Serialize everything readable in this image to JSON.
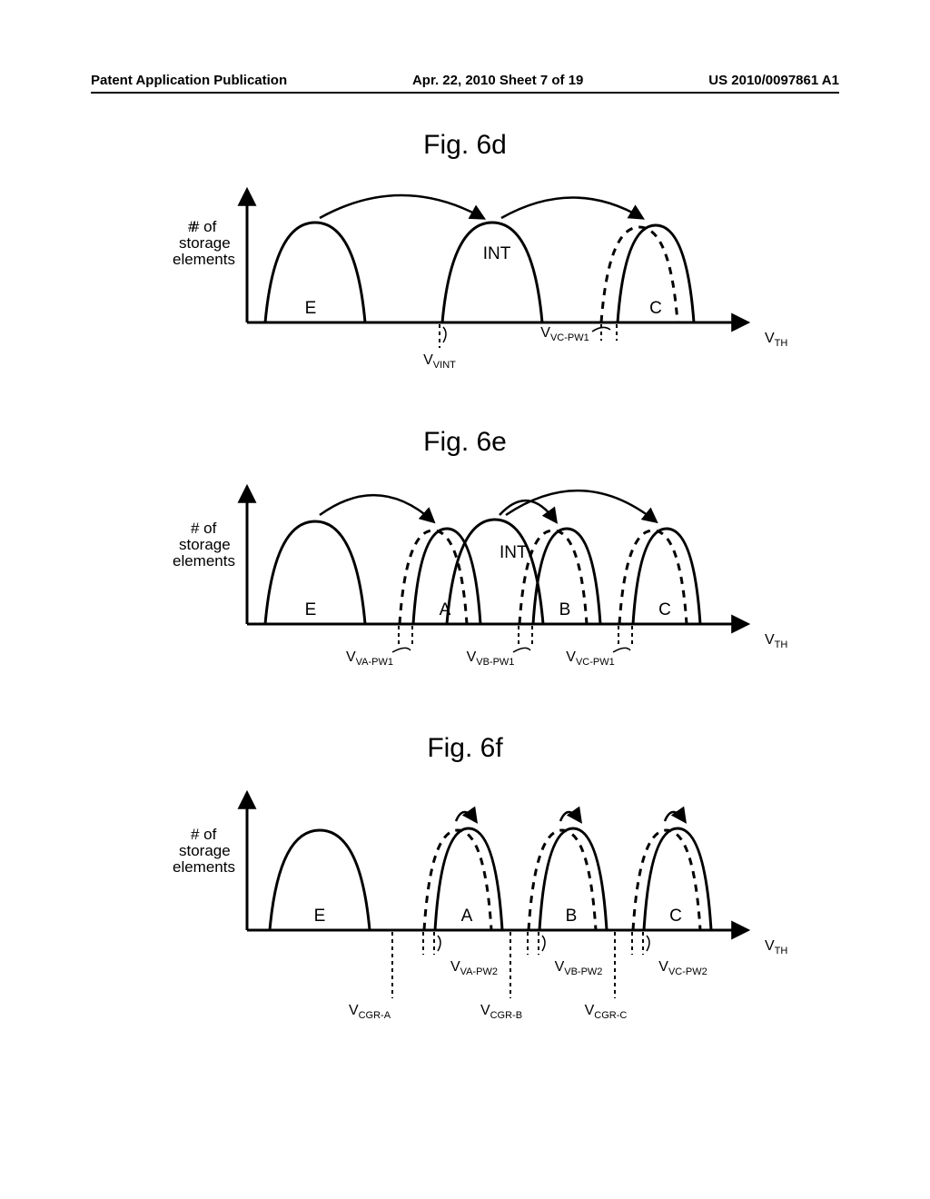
{
  "header": {
    "left": "Patent Application Publication",
    "center": "Apr. 22, 2010  Sheet 7 of 19",
    "right": "US 2010/0097861 A1"
  },
  "figures": {
    "d": {
      "title": "Fig. 6d",
      "ylabel": "# of\nstorage\nelements",
      "xaxis": "V_TH",
      "states": {
        "E": "E",
        "INT": "INT",
        "C": "C"
      },
      "ticks": {
        "vint": "V_VINT",
        "vc": "V_VC-PW1"
      }
    },
    "e": {
      "title": "Fig. 6e",
      "ylabel": "# of\nstorage\nelements",
      "xaxis": "V_TH",
      "states": {
        "E": "E",
        "INT": "INT",
        "A": "A",
        "B": "B",
        "C": "C"
      },
      "ticks": {
        "va": "V_VA-PW1",
        "vb": "V_VB-PW1",
        "vc": "V_VC-PW1"
      }
    },
    "f": {
      "title": "Fig. 6f",
      "ylabel": "# of\nstorage\nelements",
      "xaxis": "V_TH",
      "states": {
        "E": "E",
        "A": "A",
        "B": "B",
        "C": "C"
      },
      "ticks": {
        "va2": "V_VA-PW2",
        "vb2": "V_VB-PW2",
        "vc2": "V_VC-PW2",
        "cgrA": "V_CGR-A",
        "cgrB": "V_CGR-B",
        "cgrC": "V_CGR-C"
      }
    }
  },
  "chart_data": [
    {
      "type": "distribution",
      "figure": "6d",
      "xaxis": "V_TH (threshold voltage, arbitrary units)",
      "yaxis": "# of storage elements",
      "distributions": [
        {
          "name": "E",
          "center": 1.3,
          "width": 1.2,
          "style": "solid"
        },
        {
          "name": "INT",
          "center": 4.6,
          "width": 1.2,
          "style": "solid"
        },
        {
          "name": "C (pre-shift)",
          "center": 7.0,
          "width": 1.0,
          "style": "dashed"
        },
        {
          "name": "C (post-shift)",
          "center": 7.3,
          "width": 1.0,
          "style": "solid"
        }
      ],
      "verify_levels": {
        "V_VINT": 3.9,
        "V_VC-PW1": 6.5
      },
      "transitions": [
        {
          "from": "E",
          "to": "INT"
        },
        {
          "from": "INT",
          "to": "C"
        }
      ]
    },
    {
      "type": "distribution",
      "figure": "6e",
      "xaxis": "V_TH (threshold voltage, arbitrary units)",
      "yaxis": "# of storage elements",
      "distributions": [
        {
          "name": "E",
          "center": 1.3,
          "width": 1.2,
          "style": "solid"
        },
        {
          "name": "INT",
          "center": 4.6,
          "width": 1.2,
          "style": "solid"
        },
        {
          "name": "A (pre-shift)",
          "center": 3.6,
          "width": 1.0,
          "style": "dashed"
        },
        {
          "name": "A (post-shift)",
          "center": 3.9,
          "width": 1.0,
          "style": "solid"
        },
        {
          "name": "B (pre-shift)",
          "center": 5.5,
          "width": 1.0,
          "style": "dashed"
        },
        {
          "name": "B (post-shift)",
          "center": 5.8,
          "width": 1.0,
          "style": "solid"
        },
        {
          "name": "C (pre-shift)",
          "center": 7.0,
          "width": 1.0,
          "style": "dashed"
        },
        {
          "name": "C (post-shift)",
          "center": 7.3,
          "width": 1.0,
          "style": "solid"
        }
      ],
      "verify_levels": {
        "V_VA-PW1": 3.1,
        "V_VB-PW1": 5.0,
        "V_VC-PW1": 6.5
      },
      "transitions": [
        {
          "from": "E",
          "to": "A"
        },
        {
          "from": "INT",
          "to": "B"
        },
        {
          "from": "INT",
          "to": "C"
        }
      ]
    },
    {
      "type": "distribution",
      "figure": "6f",
      "xaxis": "V_TH (threshold voltage, arbitrary units)",
      "yaxis": "# of storage elements",
      "distributions": [
        {
          "name": "E",
          "center": 1.6,
          "width": 1.2,
          "style": "solid"
        },
        {
          "name": "A (pre)",
          "center": 4.0,
          "width": 1.0,
          "style": "dashed"
        },
        {
          "name": "A (post)",
          "center": 4.2,
          "width": 1.0,
          "style": "solid"
        },
        {
          "name": "B (pre)",
          "center": 5.6,
          "width": 1.0,
          "style": "dashed"
        },
        {
          "name": "B (post)",
          "center": 5.8,
          "width": 1.0,
          "style": "solid"
        },
        {
          "name": "C (pre)",
          "center": 7.2,
          "width": 1.0,
          "style": "dashed"
        },
        {
          "name": "C (post)",
          "center": 7.4,
          "width": 1.0,
          "style": "solid"
        }
      ],
      "verify_levels": {
        "V_VA-PW2": 3.7,
        "V_VB-PW2": 5.3,
        "V_VC-PW2": 6.9
      },
      "read_levels": {
        "V_CGR-A": 3.1,
        "V_CGR-B": 4.9,
        "V_CGR-C": 6.5
      },
      "transitions": [
        {
          "from": "A(pre)",
          "to": "A(post)"
        },
        {
          "from": "B(pre)",
          "to": "B(post)"
        },
        {
          "from": "C(pre)",
          "to": "C(post)"
        }
      ]
    }
  ]
}
